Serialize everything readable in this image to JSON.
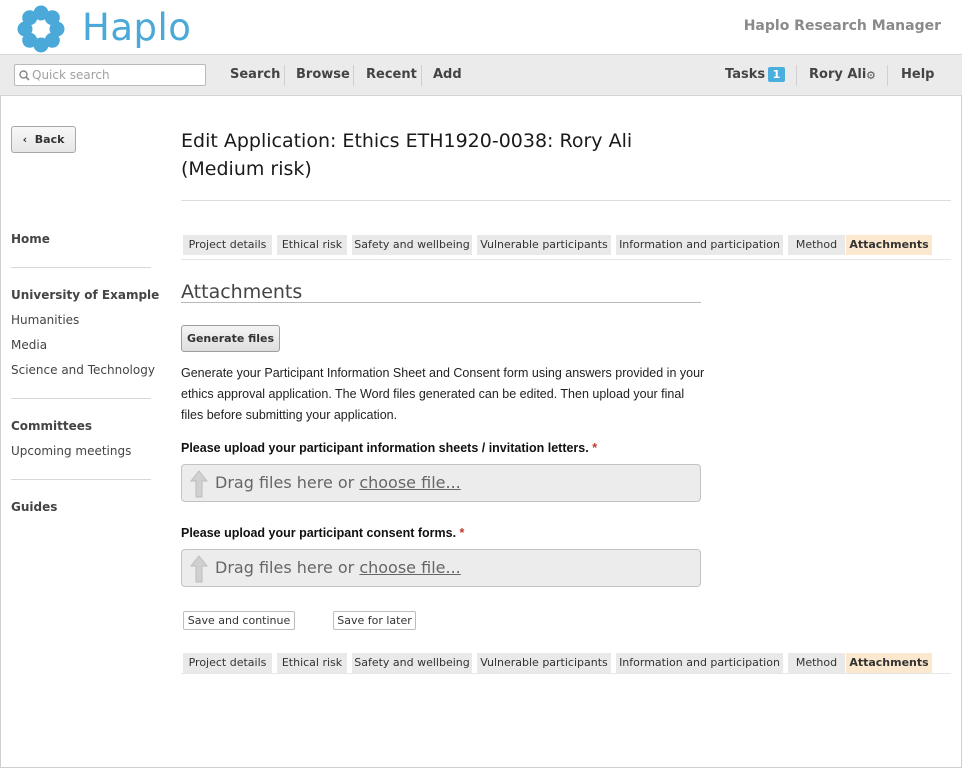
{
  "header": {
    "brand": "Haplo",
    "app_name": "Haplo Research Manager"
  },
  "nav": {
    "search_placeholder": "Quick search",
    "items": [
      "Search",
      "Browse",
      "Recent",
      "Add"
    ],
    "tasks_label": "Tasks",
    "tasks_count": "1",
    "user": "Rory Ali",
    "help": "Help"
  },
  "sidebar": {
    "back": "Back",
    "home": "Home",
    "org": "University of Example",
    "org_links": [
      "Humanities",
      "Media",
      "Science and Technology"
    ],
    "committees": "Committees",
    "committee_links": [
      "Upcoming meetings"
    ],
    "guides": "Guides"
  },
  "main": {
    "title": "Edit Application: Ethics ETH1920-0038: Rory Ali (Medium risk)",
    "tabs": [
      "Project details",
      "Ethical risk",
      "Safety and wellbeing",
      "Vulnerable participants",
      "Information and participation",
      "Method",
      "Attachments"
    ],
    "active_tab": "Attachments",
    "section_title": "Attachments",
    "generate_button": "Generate files",
    "description": "Generate your Participant Information Sheet and Consent form using answers provided in your ethics approval application. The Word files generated can be edited. Then upload your final files before submitting your application.",
    "question1": "Please upload your participant information sheets / invitation letters.",
    "question2": "Please upload your participant consent forms.",
    "required_mark": "*",
    "dropzone_text": "Drag files here or ",
    "dropzone_link": "choose file...",
    "save_continue": "Save and continue",
    "save_later": "Save for later"
  },
  "colors": {
    "brand": "#4aa9d8",
    "active_tab": "#fbe8cf",
    "badge": "#4aaedf"
  }
}
